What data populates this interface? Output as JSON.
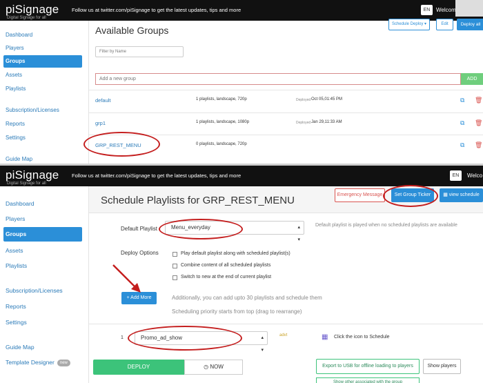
{
  "screen1": {
    "header": {
      "logo": "piSignage",
      "logo_sub": "Digital Signage for all",
      "follow_text": "Follow us at twitter.com/piSignage to get the latest updates, tips and more",
      "lang": "EN",
      "welcome": "Welcom"
    },
    "sidebar": {
      "items": [
        {
          "label": "Dashboard"
        },
        {
          "label": "Players"
        },
        {
          "label": "Groups"
        },
        {
          "label": "Assets"
        },
        {
          "label": "Playlists"
        },
        {
          "label": "Subscription/Licenses"
        },
        {
          "label": "Reports"
        },
        {
          "label": "Settings"
        },
        {
          "label": "Guide Map"
        }
      ]
    },
    "main": {
      "title": "Available Groups",
      "schedule_deploy": "Schedule Deploy",
      "edit": "Edit",
      "deploy_all": "Deploy all",
      "filter_placeholder": "Filter by Name",
      "add_placeholder": "Add a new group",
      "add_button": "ADD",
      "deployed_label": "Deployed",
      "groups": [
        {
          "name": "default",
          "desc": "1 playlists, landscape, 720p",
          "deployed": "Oct 05,01:45 PM"
        },
        {
          "name": "grp1",
          "desc": "1 playlists, landscape, 1080p",
          "deployed": "Jan 29,11:33 AM"
        },
        {
          "name": "GRP_REST_MENU",
          "desc": "0 playlists, landscape, 720p",
          "deployed": ""
        }
      ]
    }
  },
  "screen2": {
    "header": {
      "logo": "piSignage",
      "logo_sub": "Digital Signage for all",
      "follow_text": "Follow us at twitter.com/piSignage to get the latest updates, tips and more",
      "lang": "EN",
      "welcome": "Welco"
    },
    "sidebar": {
      "items": [
        {
          "label": "Dashboard"
        },
        {
          "label": "Players"
        },
        {
          "label": "Groups"
        },
        {
          "label": "Assets"
        },
        {
          "label": "Playlists"
        },
        {
          "label": "Subscription/Licenses"
        },
        {
          "label": "Reports"
        },
        {
          "label": "Settings"
        },
        {
          "label": "Guide Map"
        },
        {
          "label": "Template Designer",
          "badge": "new"
        }
      ]
    },
    "main": {
      "title": "Schedule Playlists for GRP_REST_MENU",
      "emergency": "Emergency Message",
      "ticker": "Set Group Ticker",
      "view_schedule": "view schedule",
      "default_playlist_label": "Default Playlist",
      "default_playlist_value": "Menu_everyday",
      "default_hint": "Default playlist is played when no scheduled playlists are available",
      "deploy_options_label": "Deploy Options",
      "options": [
        "Play default playlist along with scheduled playlist(s)",
        "Combine content of all scheduled playlists",
        "Switch to new at the end of current playlist"
      ],
      "add_more": "+ Add More",
      "add_hint1": "Additionally, you can add upto 30 playlists and schedule them",
      "add_hint2": "Scheduling priority starts from top (drag to rearrange)",
      "row_number": "1",
      "scheduled_playlist": "Promo_ad_show",
      "advt": "advt",
      "cal_hint": "Click the icon to Schedule",
      "deploy": "DEPLOY",
      "now": "NOW",
      "export": "Export to USB for offline loading to players",
      "show_players": "Show players",
      "partial": "Show other associated with the group"
    }
  }
}
